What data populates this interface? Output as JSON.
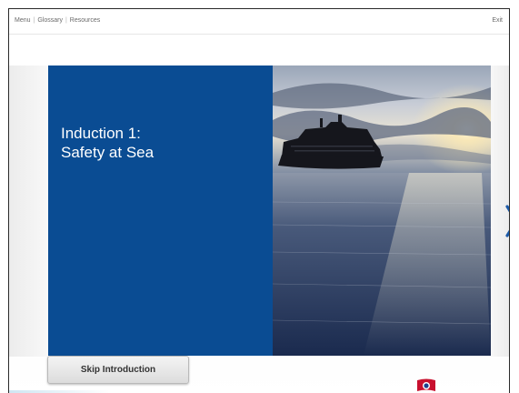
{
  "nav": {
    "items": [
      "Menu",
      "Glossary",
      "Resources"
    ],
    "separator": "|",
    "exit_label": "Exit"
  },
  "course": {
    "title": "Induction 1:\nSafety at Sea"
  },
  "hero": {
    "description_icon": "cruise-ship-at-sunset-image"
  },
  "controls": {
    "next_icon": "chevron-right-icon",
    "skip_label": "Skip Introduction"
  },
  "brand": {
    "logo_icon": "company-flag-logo",
    "colors": {
      "panel": "#0a4c93",
      "accent": "#1b5aa8",
      "logo_red": "#c8102e"
    }
  }
}
